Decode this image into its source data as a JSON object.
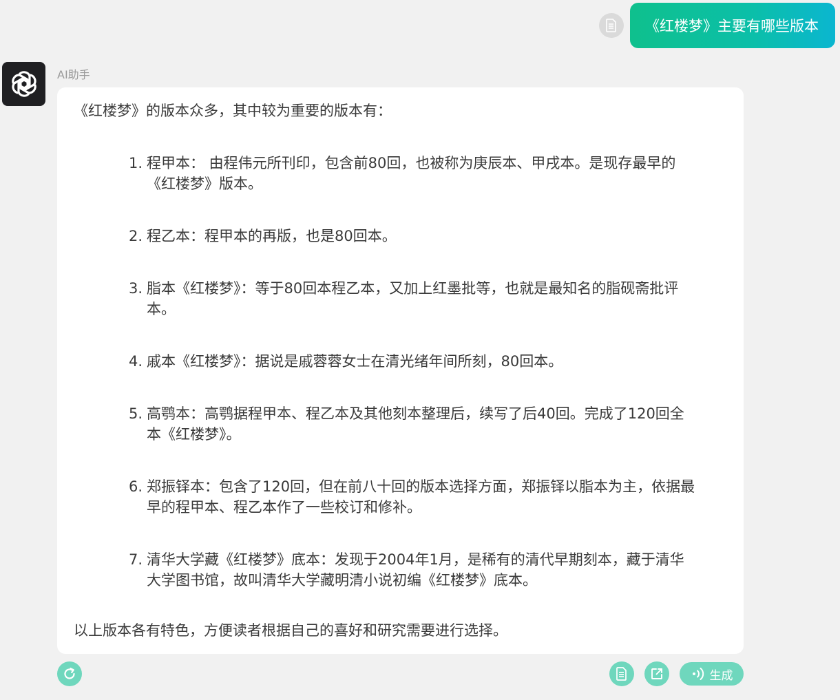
{
  "user": {
    "message": "《红楼梦》主要有哪些版本"
  },
  "assistant": {
    "name": "AI助手",
    "intro": "《红楼梦》的版本众多，其中较为重要的版本有：",
    "items": [
      {
        "num": "1.",
        "text": "程甲本： 由程伟元所刊印，包含前80回，也被称为庚辰本、甲戌本。是现存最早的《红楼梦》版本。"
      },
      {
        "num": "2.",
        "text": "程乙本：程甲本的再版，也是80回本。"
      },
      {
        "num": "3.",
        "text": "脂本《红楼梦》：等于80回本程乙本，又加上红墨批等，也就是最知名的脂砚斋批评本。"
      },
      {
        "num": "4.",
        "text": "戚本《红楼梦》：据说是戚蓉蓉女士在清光绪年间所刻，80回本。"
      },
      {
        "num": "5.",
        "text": "高鹗本：高鹗据程甲本、程乙本及其他刻本整理后，续写了后40回。完成了120回全本《红楼梦》。"
      },
      {
        "num": "6.",
        "text": "郑振铎本：包含了120回，但在前八十回的版本选择方面，郑振铎以脂本为主，依据最早的程甲本、程乙本作了一些校订和修补。"
      },
      {
        "num": "7.",
        "text": "清华大学藏《红楼梦》底本：发现于2004年1月，是稀有的清代早期刻本，藏于清华大学图书馆，故叫清华大学藏明清小说初编《红楼梦》底本。"
      }
    ],
    "outro": "以上版本各有特色，方便读者根据自己的喜好和研究需要进行选择。"
  },
  "toolbar": {
    "generate_label": "生成"
  },
  "icons": {
    "avatar": "openai-logo-icon",
    "user_doc": "document-icon",
    "regenerate": "refresh-icon",
    "copy": "document-icon",
    "share": "share-icon",
    "generate": "audio-wave-icon"
  },
  "colors": {
    "accent": "#0fc08d",
    "accent_light": "#6fd7bd",
    "user_bubble_end": "#0bb6d0",
    "background": "#f1f1f1",
    "card": "#ffffff"
  }
}
